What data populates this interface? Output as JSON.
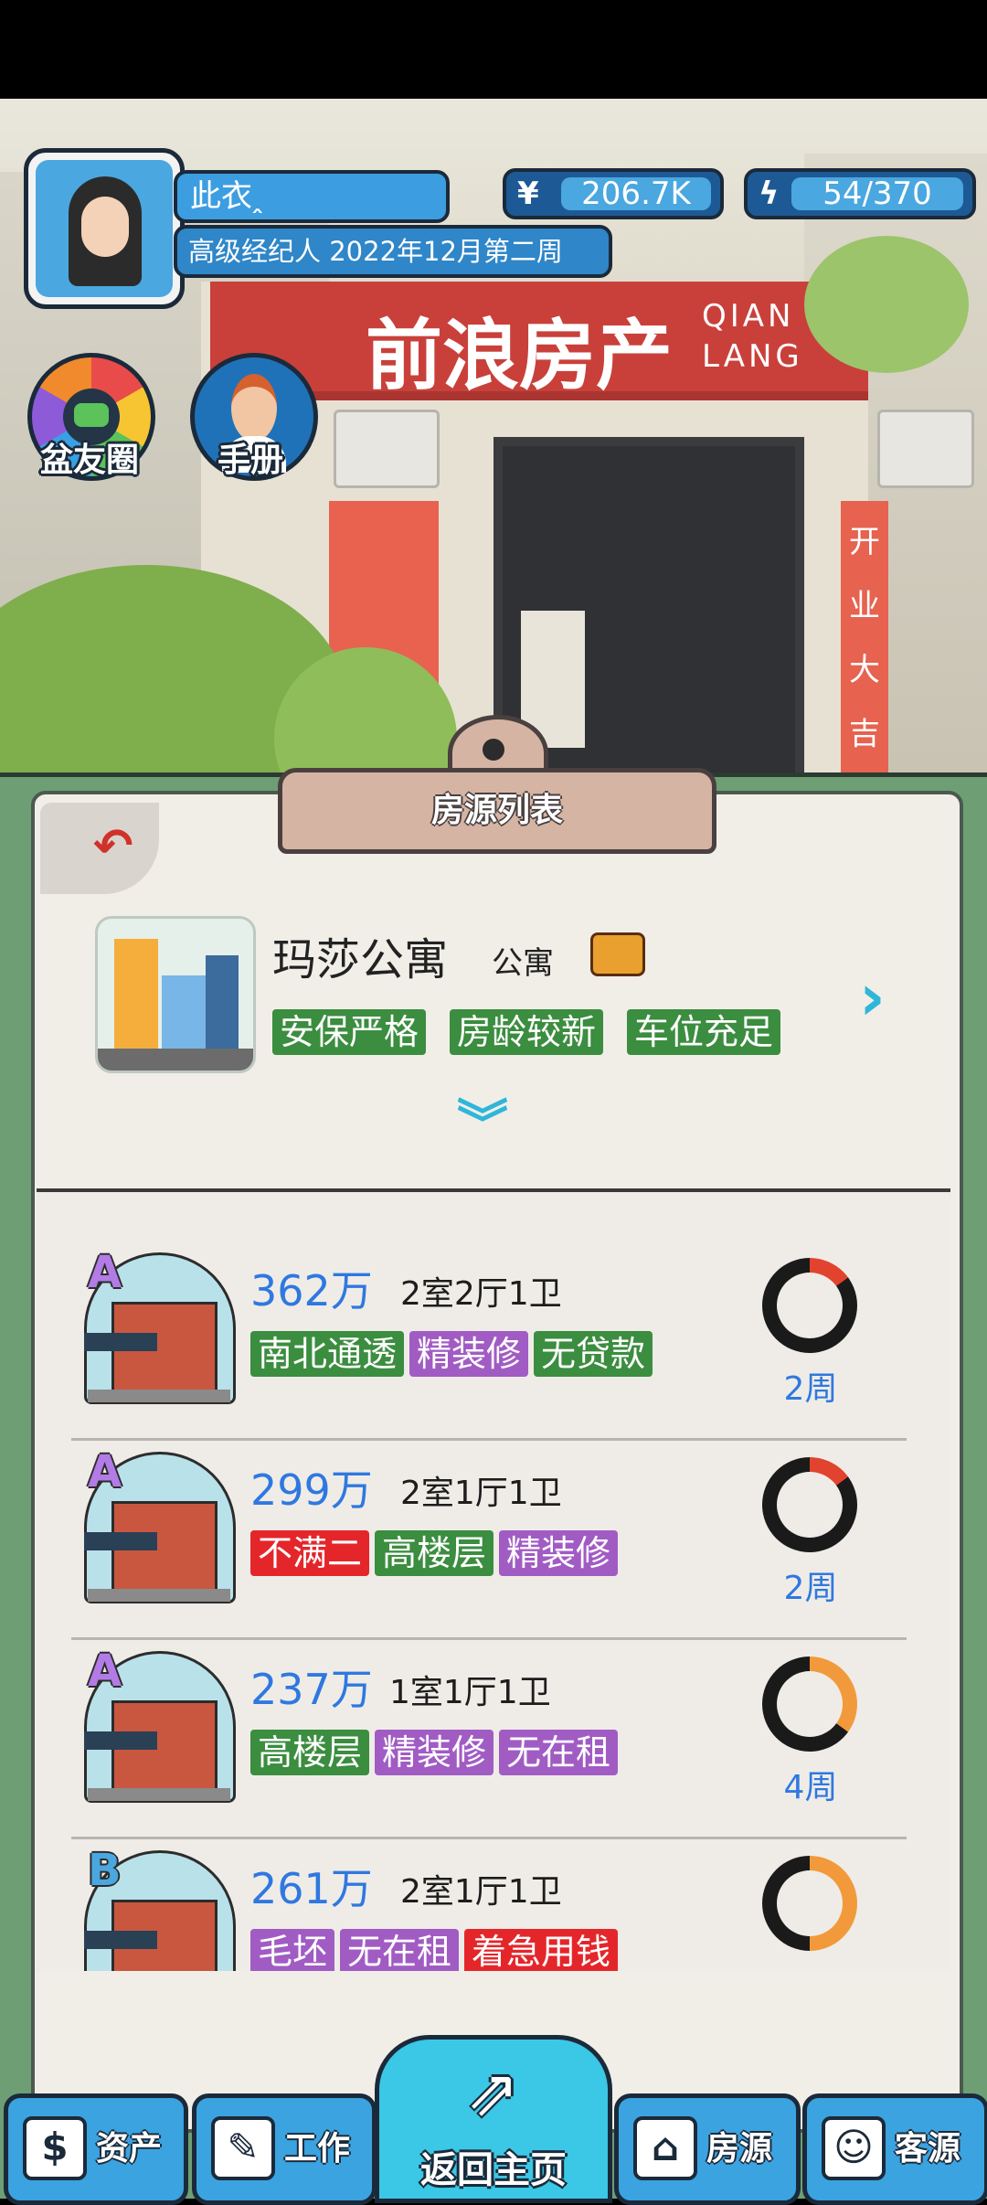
{
  "player": {
    "name": "此衣ꞈ",
    "rank": "高级经纪人 2022年12月第二周",
    "money_symbol": "¥",
    "money": "206.7K",
    "energy_icon": "lightning-bolt",
    "energy": "54/370"
  },
  "scene": {
    "sign_main": "前浪房产",
    "sign_latin_1": "QIAN",
    "sign_latin_2": "LANG",
    "banner_text": "开业大吉"
  },
  "shortcuts": {
    "friends_label": "盆友圈",
    "manual_label": "手册"
  },
  "panel": {
    "title": "房源列表",
    "back_icon": "back-arrow"
  },
  "complex": {
    "name": "玛莎公寓",
    "type": "公寓",
    "tags": [
      {
        "text": "安保严格",
        "color": "#3b8d3f"
      },
      {
        "text": "房龄较新",
        "color": "#3b8d3f"
      },
      {
        "text": "车位充足",
        "color": "#3b8d3f"
      }
    ]
  },
  "listings": [
    {
      "grade": "A",
      "price": "362万",
      "layout": "2室2厅1卫",
      "weeks": "2周",
      "progress": 0.15,
      "ring_color": "#e2432e",
      "tags": [
        {
          "text": "南北通透",
          "cls": "green"
        },
        {
          "text": "精装修",
          "cls": "purple"
        },
        {
          "text": "无贷款",
          "cls": "green"
        }
      ]
    },
    {
      "grade": "A",
      "price": "299万",
      "layout": "2室1厅1卫",
      "weeks": "2周",
      "progress": 0.15,
      "ring_color": "#e2432e",
      "tags": [
        {
          "text": "不满二",
          "cls": "red"
        },
        {
          "text": "高楼层",
          "cls": "green"
        },
        {
          "text": "精装修",
          "cls": "purple"
        }
      ]
    },
    {
      "grade": "A",
      "price": "237万",
      "layout": "1室1厅1卫",
      "weeks": "4周",
      "progress": 0.35,
      "ring_color": "#f29a3b",
      "tags": [
        {
          "text": "高楼层",
          "cls": "green"
        },
        {
          "text": "精装修",
          "cls": "purple"
        },
        {
          "text": "无在租",
          "cls": "purple"
        }
      ]
    },
    {
      "grade": "B",
      "price": "261万",
      "layout": "2室1厅1卫",
      "weeks": "",
      "progress": 0.5,
      "ring_color": "#f29a3b",
      "tags": [
        {
          "text": "毛坯",
          "cls": "purple"
        },
        {
          "text": "无在租",
          "cls": "purple"
        },
        {
          "text": "着急用钱",
          "cls": "red"
        }
      ]
    }
  ],
  "nav": {
    "assets": "资产",
    "work": "工作",
    "home": "返回主页",
    "listings": "房源",
    "clients": "客源"
  }
}
